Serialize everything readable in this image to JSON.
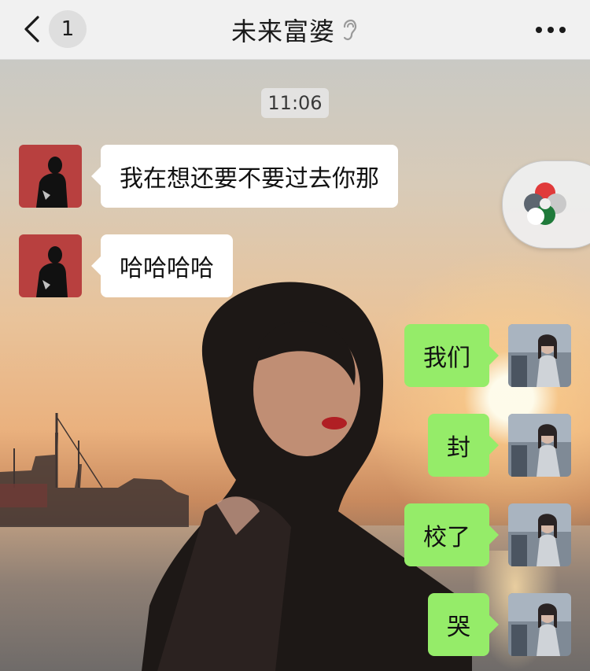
{
  "header": {
    "back_label": "back",
    "unread_count": "1",
    "title": "未来富婆",
    "muted_icon": "ear-icon",
    "more_icon": "more-dots-icon",
    "background_color": "#f1f1f1"
  },
  "timestamp": "11:06",
  "messages": [
    {
      "side": "left",
      "text": "我在想还要不要过去你那",
      "avatar": "contact-avatar"
    },
    {
      "side": "left",
      "text": "哈哈哈哈",
      "avatar": "contact-avatar"
    },
    {
      "side": "right",
      "text": "我们",
      "avatar": "self-avatar"
    },
    {
      "side": "right",
      "text": "封",
      "avatar": "self-avatar"
    },
    {
      "side": "right",
      "text": "校了",
      "avatar": "self-avatar"
    },
    {
      "side": "right",
      "text": "哭",
      "avatar": "self-avatar"
    }
  ],
  "floating_widget": {
    "icon": "floating-window-icon"
  },
  "colors": {
    "incoming_bubble": "#ffffff",
    "outgoing_bubble": "#95ec69",
    "contact_avatar_bg": "#b8403f"
  }
}
